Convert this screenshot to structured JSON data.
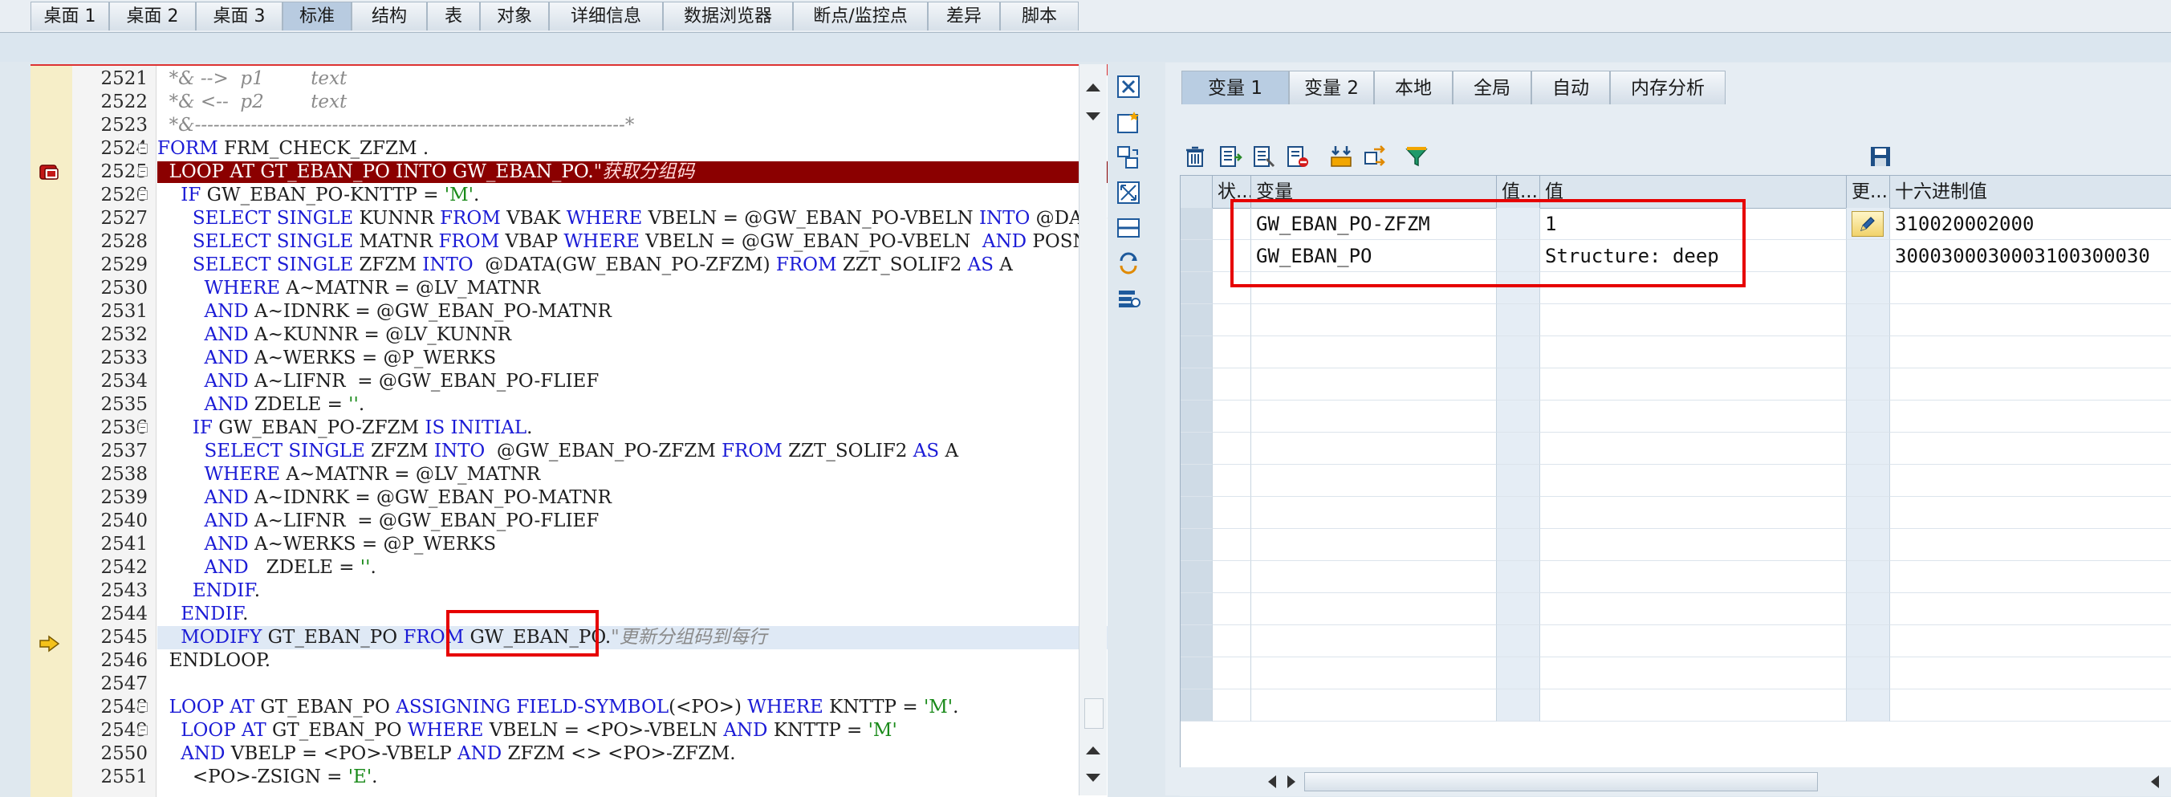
{
  "top_tabs": [
    {
      "label": "桌面 1",
      "active": false
    },
    {
      "label": "桌面 2",
      "active": false
    },
    {
      "label": "桌面 3",
      "active": false
    },
    {
      "label": "标准",
      "active": true
    },
    {
      "label": "结构",
      "active": false
    },
    {
      "label": "表",
      "active": false
    },
    {
      "label": "对象",
      "active": false
    },
    {
      "label": "详细信息",
      "active": false
    },
    {
      "label": "数据浏览器",
      "active": false
    },
    {
      "label": "断点/监控点",
      "active": false
    },
    {
      "label": "差异",
      "active": false
    },
    {
      "label": "脚本",
      "active": false
    }
  ],
  "editor": {
    "lines": [
      {
        "num": "2521",
        "parts": [
          {
            "t": "  *& -->  p1        text",
            "c": "cmt"
          }
        ]
      },
      {
        "num": "2522",
        "parts": [
          {
            "t": "  *& <--  p2        text",
            "c": "cmt"
          }
        ]
      },
      {
        "num": "2523",
        "parts": [
          {
            "t": "  *&---------------------------------------------------------------------*",
            "c": "cmt"
          }
        ]
      },
      {
        "num": "2524",
        "parts": [
          {
            "t": "FORM ",
            "c": "kw"
          },
          {
            "t": "FRM_CHECK_ZFZM .",
            "c": "plain"
          }
        ]
      },
      {
        "num": "2525",
        "parts": [
          {
            "t": "  LOOP AT GT_EBAN_PO INTO GW_EBAN_PO.",
            "c": "white"
          },
          {
            "t": "\"获取分组码",
            "c": "ccmt"
          }
        ]
      },
      {
        "num": "2526",
        "parts": [
          {
            "t": "    IF ",
            "c": "kw"
          },
          {
            "t": "GW_EBAN_PO-KNTTP = ",
            "c": "plain"
          },
          {
            "t": "'M'",
            "c": "str"
          },
          {
            "t": ".",
            "c": "plain"
          }
        ]
      },
      {
        "num": "2527",
        "parts": [
          {
            "t": "      SELECT SINGLE ",
            "c": "kw"
          },
          {
            "t": "KUNNR ",
            "c": "plain"
          },
          {
            "t": "FROM ",
            "c": "kw"
          },
          {
            "t": "VBAK ",
            "c": "plain"
          },
          {
            "t": "WHERE ",
            "c": "kw"
          },
          {
            "t": "VBELN = @GW_EBAN_PO-VBELN ",
            "c": "plain"
          },
          {
            "t": "INTO ",
            "c": "kw"
          },
          {
            "t": "@DATA(LV_",
            "c": "plain"
          }
        ]
      },
      {
        "num": "2528",
        "parts": [
          {
            "t": "      SELECT SINGLE ",
            "c": "kw"
          },
          {
            "t": "MATNR ",
            "c": "plain"
          },
          {
            "t": "FROM ",
            "c": "kw"
          },
          {
            "t": "VBAP ",
            "c": "plain"
          },
          {
            "t": "WHERE ",
            "c": "kw"
          },
          {
            "t": "VBELN = @GW_EBAN_PO-VBELN  ",
            "c": "plain"
          },
          {
            "t": "AND ",
            "c": "kw"
          },
          {
            "t": "POSNR = @",
            "c": "plain"
          }
        ]
      },
      {
        "num": "2529",
        "parts": [
          {
            "t": "      SELECT SINGLE ",
            "c": "kw"
          },
          {
            "t": "ZFZM ",
            "c": "plain"
          },
          {
            "t": "INTO  ",
            "c": "kw"
          },
          {
            "t": "@DATA(GW_EBAN_PO-ZFZM) ",
            "c": "plain"
          },
          {
            "t": "FROM ",
            "c": "kw"
          },
          {
            "t": "ZZT_SOLIF2 ",
            "c": "plain"
          },
          {
            "t": "AS ",
            "c": "kw"
          },
          {
            "t": "A",
            "c": "plain"
          }
        ]
      },
      {
        "num": "2530",
        "parts": [
          {
            "t": "        WHERE ",
            "c": "kw"
          },
          {
            "t": "A~MATNR = @LV_MATNR",
            "c": "plain"
          }
        ]
      },
      {
        "num": "2531",
        "parts": [
          {
            "t": "        AND ",
            "c": "kw"
          },
          {
            "t": "A~IDNRK = @GW_EBAN_PO-MATNR",
            "c": "plain"
          }
        ]
      },
      {
        "num": "2532",
        "parts": [
          {
            "t": "        AND ",
            "c": "kw"
          },
          {
            "t": "A~KUNNR = @LV_KUNNR",
            "c": "plain"
          }
        ]
      },
      {
        "num": "2533",
        "parts": [
          {
            "t": "        AND ",
            "c": "kw"
          },
          {
            "t": "A~WERKS = @P_WERKS",
            "c": "plain"
          }
        ]
      },
      {
        "num": "2534",
        "parts": [
          {
            "t": "        AND ",
            "c": "kw"
          },
          {
            "t": "A~LIFNR  = @GW_EBAN_PO-FLIEF",
            "c": "plain"
          }
        ]
      },
      {
        "num": "2535",
        "parts": [
          {
            "t": "        AND ",
            "c": "kw"
          },
          {
            "t": "ZDELE = ",
            "c": "plain"
          },
          {
            "t": "''",
            "c": "str"
          },
          {
            "t": ".",
            "c": "plain"
          }
        ]
      },
      {
        "num": "2536",
        "parts": [
          {
            "t": "      IF ",
            "c": "kw"
          },
          {
            "t": "GW_EBAN_PO-ZFZM ",
            "c": "plain"
          },
          {
            "t": "IS INITIAL",
            "c": "kw"
          },
          {
            "t": ".",
            "c": "plain"
          }
        ]
      },
      {
        "num": "2537",
        "parts": [
          {
            "t": "        SELECT SINGLE ",
            "c": "kw"
          },
          {
            "t": "ZFZM ",
            "c": "plain"
          },
          {
            "t": "INTO  ",
            "c": "kw"
          },
          {
            "t": "@GW_EBAN_PO-ZFZM ",
            "c": "plain"
          },
          {
            "t": "FROM ",
            "c": "kw"
          },
          {
            "t": "ZZT_SOLIF2 ",
            "c": "plain"
          },
          {
            "t": "AS ",
            "c": "kw"
          },
          {
            "t": "A",
            "c": "plain"
          }
        ]
      },
      {
        "num": "2538",
        "parts": [
          {
            "t": "        WHERE ",
            "c": "kw"
          },
          {
            "t": "A~MATNR = @LV_MATNR",
            "c": "plain"
          }
        ]
      },
      {
        "num": "2539",
        "parts": [
          {
            "t": "        AND ",
            "c": "kw"
          },
          {
            "t": "A~IDNRK = @GW_EBAN_PO-MATNR",
            "c": "plain"
          }
        ]
      },
      {
        "num": "2540",
        "parts": [
          {
            "t": "        AND ",
            "c": "kw"
          },
          {
            "t": "A~LIFNR  = @GW_EBAN_PO-FLIEF",
            "c": "plain"
          }
        ]
      },
      {
        "num": "2541",
        "parts": [
          {
            "t": "        AND ",
            "c": "kw"
          },
          {
            "t": "A~WERKS = @P_WERKS",
            "c": "plain"
          }
        ]
      },
      {
        "num": "2542",
        "parts": [
          {
            "t": "        AND   ",
            "c": "kw"
          },
          {
            "t": "ZDELE = ",
            "c": "plain"
          },
          {
            "t": "''",
            "c": "str"
          },
          {
            "t": ".",
            "c": "plain"
          }
        ]
      },
      {
        "num": "2543",
        "parts": [
          {
            "t": "      ENDIF",
            "c": "kw"
          },
          {
            "t": ".",
            "c": "plain"
          }
        ]
      },
      {
        "num": "2544",
        "parts": [
          {
            "t": "    ENDIF",
            "c": "kw"
          },
          {
            "t": ".",
            "c": "plain"
          }
        ]
      },
      {
        "num": "2545",
        "parts": [
          {
            "t": "    MODIFY ",
            "c": "kw"
          },
          {
            "t": "GT_EBAN_PO ",
            "c": "plain"
          },
          {
            "t": "FROM ",
            "c": "kw"
          },
          {
            "t": "GW_EBAN_PO.",
            "c": "plain"
          },
          {
            "t": "\"更新分组码到每行",
            "c": "cmt"
          }
        ]
      },
      {
        "num": "2546",
        "parts": [
          {
            "t": "  ENDLOOP",
            "c": "plain"
          },
          {
            "t": ".",
            "c": "plain"
          }
        ]
      },
      {
        "num": "2547",
        "parts": []
      },
      {
        "num": "2548",
        "parts": [
          {
            "t": "  LOOP AT ",
            "c": "kw"
          },
          {
            "t": "GT_EBAN_PO ",
            "c": "plain"
          },
          {
            "t": "ASSIGNING FIELD-SYMBOL",
            "c": "kw"
          },
          {
            "t": "(<PO>) ",
            "c": "plain"
          },
          {
            "t": "WHERE ",
            "c": "kw"
          },
          {
            "t": "KNTTP = ",
            "c": "plain"
          },
          {
            "t": "'M'",
            "c": "str"
          },
          {
            "t": ".",
            "c": "plain"
          }
        ]
      },
      {
        "num": "2549",
        "parts": [
          {
            "t": "    LOOP AT ",
            "c": "kw"
          },
          {
            "t": "GT_EBAN_PO ",
            "c": "plain"
          },
          {
            "t": "WHERE ",
            "c": "kw"
          },
          {
            "t": "VBELN = <PO>-VBELN ",
            "c": "plain"
          },
          {
            "t": "AND ",
            "c": "kw"
          },
          {
            "t": "KNTTP = ",
            "c": "plain"
          },
          {
            "t": "'M'",
            "c": "str"
          }
        ]
      },
      {
        "num": "2550",
        "parts": [
          {
            "t": "    AND ",
            "c": "kw"
          },
          {
            "t": "VBELP = <PO>-VBELP ",
            "c": "plain"
          },
          {
            "t": "AND ",
            "c": "kw"
          },
          {
            "t": "ZFZM <> <PO>-ZFZM.",
            "c": "plain"
          }
        ]
      },
      {
        "num": "2551",
        "parts": [
          {
            "t": "      <PO>-ZSIGN = ",
            "c": "plain"
          },
          {
            "t": "'E'",
            "c": "str"
          },
          {
            "t": ".",
            "c": "plain"
          }
        ]
      }
    ]
  },
  "var_tabs": [
    {
      "label": "变量 1",
      "active": true
    },
    {
      "label": "变量 2",
      "active": false
    },
    {
      "label": "本地",
      "active": false
    },
    {
      "label": "全局",
      "active": false
    },
    {
      "label": "自动",
      "active": false
    },
    {
      "label": "内存分析",
      "active": false
    }
  ],
  "var_grid": {
    "headers": [
      "状...",
      "变量",
      "值...",
      "值",
      "更...",
      "十六进制值"
    ],
    "rows": [
      {
        "variable": "GW_EBAN_PO-ZFZM",
        "value": "1",
        "hex": "310020002000",
        "editable": true
      },
      {
        "variable": "GW_EBAN_PO",
        "value": "Structure: deep",
        "hex": "3000300030003100300030",
        "editable": false
      }
    ],
    "empty_rows": 14
  },
  "colors": {
    "keyword": "#1b1bd6",
    "string": "#1a8a1a",
    "comment": "#8a8a8a",
    "breakpoint_line": "#8b0000",
    "annotation_red": "#e60000"
  }
}
